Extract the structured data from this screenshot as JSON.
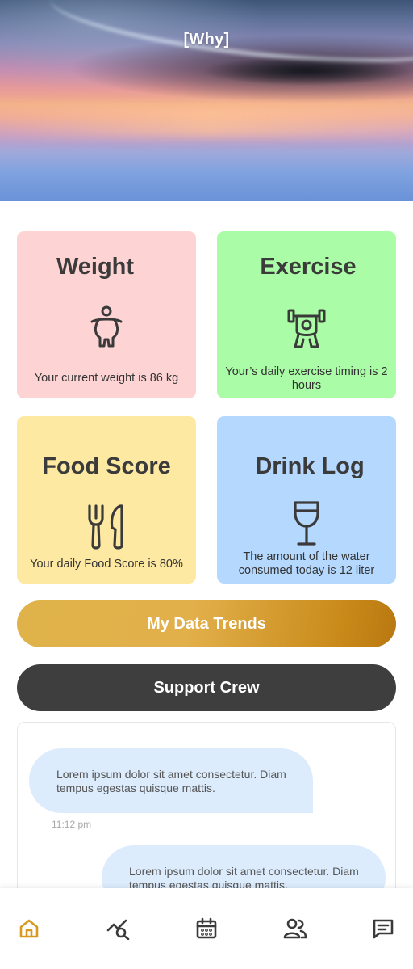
{
  "hero": {
    "title": "[Why]"
  },
  "cards": {
    "weight": {
      "title": "Weight",
      "desc": "Your current weight is 86 kg",
      "icon": "body-weight-icon"
    },
    "exercise": {
      "title": "Exercise",
      "desc": "Your’s daily exercise timing is 2 hours",
      "icon": "weightlifting-icon"
    },
    "food": {
      "title": "Food Score",
      "desc": "Your daily Food Score is 80%",
      "icon": "fork-knife-icon"
    },
    "drink": {
      "title": "Drink Log",
      "desc": "The amount of the water consumed today is 12 liter",
      "icon": "wine-glass-icon"
    }
  },
  "buttons": {
    "trends": "My Data Trends",
    "crew": "Support Crew"
  },
  "chat": {
    "messages": [
      {
        "text": "Lorem ipsum dolor sit amet consectetur. Diam tempus egestas quisque mattis.",
        "time": "11:12 pm"
      },
      {
        "text": "Lorem ipsum dolor sit amet consectetur. Diam tempus egestas quisque mattis."
      }
    ]
  },
  "nav": {
    "active_color": "#d89a1e",
    "icon_color": "#3a3a3a",
    "items": [
      "home-icon",
      "trends-search-icon",
      "calendar-icon",
      "people-icon",
      "message-icon"
    ]
  }
}
